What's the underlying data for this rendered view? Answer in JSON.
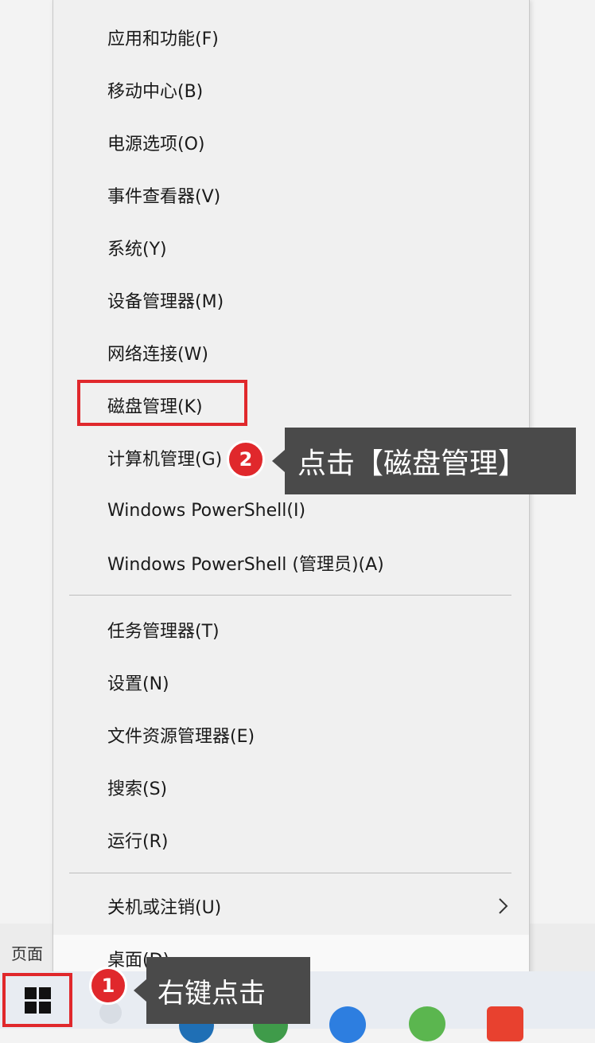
{
  "menu": {
    "group1": [
      {
        "label": "应用和功能(F)"
      },
      {
        "label": "移动中心(B)"
      },
      {
        "label": "电源选项(O)"
      },
      {
        "label": "事件查看器(V)"
      },
      {
        "label": "系统(Y)"
      },
      {
        "label": "设备管理器(M)"
      },
      {
        "label": "网络连接(W)"
      },
      {
        "label": "磁盘管理(K)"
      },
      {
        "label": "计算机管理(G)"
      },
      {
        "label": "Windows PowerShell(I)"
      },
      {
        "label": "Windows PowerShell (管理员)(A)"
      }
    ],
    "group2": [
      {
        "label": "任务管理器(T)"
      },
      {
        "label": "设置(N)"
      },
      {
        "label": "文件资源管理器(E)"
      },
      {
        "label": "搜索(S)"
      },
      {
        "label": "运行(R)"
      }
    ],
    "shutdown_label": "关机或注销(U)",
    "desktop_label": "桌面(D)"
  },
  "side_label": "页面",
  "annotations": {
    "step1_number": "1",
    "step1_text": "右键点击",
    "step2_number": "2",
    "step2_text": "点击【磁盘管理】"
  },
  "colors": {
    "highlight": "#e0282c",
    "callout_bg": "#4a4a4a"
  }
}
